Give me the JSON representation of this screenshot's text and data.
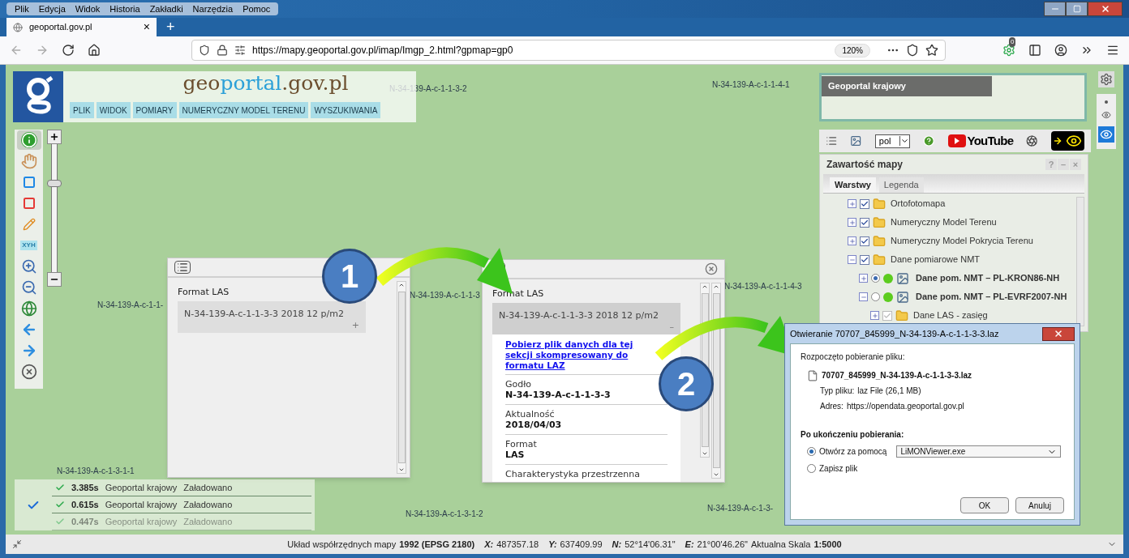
{
  "browser": {
    "menu": [
      "Plik",
      "Edycja",
      "Widok",
      "Historia",
      "Zakładki",
      "Narzędzia",
      "Pomoc"
    ],
    "tab": {
      "title": "geoportal.gov.pl",
      "selected": true,
      "close": "×"
    },
    "new_tab": "+",
    "url": "https://mapy.geoportal.gov.pl/imap/Imgp_2.html?gpmap=gp0",
    "zoom": "120%",
    "extension_badge": "0"
  },
  "header": {
    "logo": {
      "prefix": "geo",
      "highlight": "portal",
      "suffix": ".gov.pl"
    },
    "menu": [
      "PLIK",
      "WIDOK",
      "POMIARY",
      "NUMERYCZNY MODEL TERENU",
      "WYSZUKIWANIA"
    ]
  },
  "zoom_slider": {
    "level": 0.7
  },
  "tools": [
    {
      "kind": "info",
      "selected": true
    },
    {
      "kind": "pan",
      "selected": false
    },
    {
      "kind": "select-blue",
      "selected": false
    },
    {
      "kind": "select-red",
      "selected": false
    },
    {
      "kind": "pencil",
      "selected": false
    },
    {
      "kind": "xyh",
      "label": "XYH",
      "selected": false
    },
    {
      "kind": "zoom-in",
      "selected": false
    },
    {
      "kind": "zoom-out",
      "selected": false
    },
    {
      "kind": "globe",
      "selected": false
    },
    {
      "kind": "back",
      "selected": false
    },
    {
      "kind": "forward",
      "selected": false
    },
    {
      "kind": "crosshair",
      "selected": false
    }
  ],
  "map_labels": [
    "N-34-139-A-c-1-1-3-2",
    "N-34-139-A-c-1-1-4-1",
    "N-34-139-A-c-1-1-",
    "N-34-139-A-c-1-1-3",
    "N-34-139-A-c-1-1-4-3",
    "N-34-139-A-c-1-3-1-2",
    "N-34-139-A-c-1-3-1-1",
    "N-34-139-A-c-1-3-"
  ],
  "overview": {
    "title": "Geoportal krajowy"
  },
  "right_toolbar": {
    "language": "pol",
    "youtube": "YouTube",
    "contrast_on": false
  },
  "layers_panel": {
    "title": "Zawartość mapy",
    "controls": [
      "?",
      "–",
      "×"
    ],
    "tabs": [
      {
        "label": "Warstwy",
        "selected": true
      },
      {
        "label": "Legenda",
        "selected": false
      }
    ],
    "tree": [
      {
        "kind": "folder",
        "label": "Ortofotomapa",
        "checked": true,
        "disabled": false,
        "expanded": false
      },
      {
        "kind": "folder",
        "label": "Numeryczny Model Terenu",
        "checked": true,
        "disabled": false,
        "expanded": false
      },
      {
        "kind": "folder",
        "label": "Numeryczny Model Pokrycia Terenu",
        "checked": true,
        "disabled": false,
        "expanded": false
      },
      {
        "kind": "folder",
        "label": "Dane pomiarowe NMT",
        "checked": true,
        "disabled": false,
        "expanded": true,
        "children": [
          {
            "kind": "service",
            "label": "Dane pom. NMT – PL-KRON86-NH",
            "selected": true,
            "expanded": false
          },
          {
            "kind": "service",
            "label": "Dane pom. NMT – PL-EVRF2007-NH",
            "selected": false,
            "expanded": true,
            "children": [
              {
                "kind": "folder",
                "label": "Dane LAS - zasięg",
                "checked": true,
                "disabled": true,
                "expanded": false
              }
            ]
          }
        ]
      }
    ]
  },
  "popups": [
    {
      "title": "Format LAS",
      "item": "N-34-139-A-c-1-1-3-3 2018 12 p/m2",
      "toggle": "+",
      "expanded": false
    },
    {
      "title": "Format LAS",
      "item": "N-34-139-A-c-1-1-3-3 2018 12 p/m2",
      "toggle": "–",
      "expanded": true,
      "link": "Pobierz plik danych dla tej sekcji skompresowany do formatu LAZ",
      "fields": [
        {
          "label": "Godło",
          "value": "N-34-139-A-c-1-1-3-3"
        },
        {
          "label": "Aktualność",
          "value": "2018/04/03"
        },
        {
          "label": "Format",
          "value": "LAS"
        },
        {
          "label": "Charakterystyka przestrzenna"
        }
      ]
    }
  ],
  "callouts": [
    "1",
    "2"
  ],
  "dialog": {
    "title": "Otwieranie 70707_845999_N-34-139-A-c-1-1-3-3.laz",
    "intro": "Rozpoczęto pobieranie pliku:",
    "file": "70707_845999_N-34-139-A-c-1-1-3-3.laz",
    "details": [
      {
        "label": "Typ pliku:",
        "value": "laz File (26,1 MB)"
      },
      {
        "label": "Adres:",
        "value": "https://opendata.geoportal.gov.pl"
      }
    ],
    "question": "Po ukończeniu pobierania:",
    "options": [
      {
        "label": "Otwórz za pomocą",
        "selected": true
      },
      {
        "label": "Zapisz plik",
        "selected": false
      }
    ],
    "application": "LiMONViewer.exe",
    "buttons": [
      "OK",
      "Anuluj"
    ]
  },
  "load_log": [
    {
      "time": "3.385s",
      "source": "Geoportal krajowy",
      "status": "Załadowano",
      "faded": false
    },
    {
      "time": "0.615s",
      "source": "Geoportal krajowy",
      "status": "Załadowano",
      "faded": false
    },
    {
      "time": "0.447s",
      "source": "Geoportal krajowy",
      "status": "Załadowano",
      "faded": true
    }
  ],
  "status_bar": [
    {
      "kind": "plain",
      "text": "Układ współrzędnych mapy"
    },
    {
      "kind": "bold",
      "text": "1992 (EPSG 2180)"
    },
    {
      "kind": "axis",
      "text": "X:"
    },
    {
      "kind": "plain",
      "text": "487357.18"
    },
    {
      "kind": "axis",
      "text": "Y:"
    },
    {
      "kind": "plain",
      "text": "637409.99"
    },
    {
      "kind": "axis",
      "text": "N:"
    },
    {
      "kind": "plain",
      "text": "52°14'06.31\""
    },
    {
      "kind": "axis",
      "text": "E:"
    },
    {
      "kind": "plain",
      "text": "21°00'46.26\""
    },
    {
      "kind": "plain",
      "text": "Aktualna Skala"
    },
    {
      "kind": "bold",
      "text": "1:5000"
    }
  ]
}
